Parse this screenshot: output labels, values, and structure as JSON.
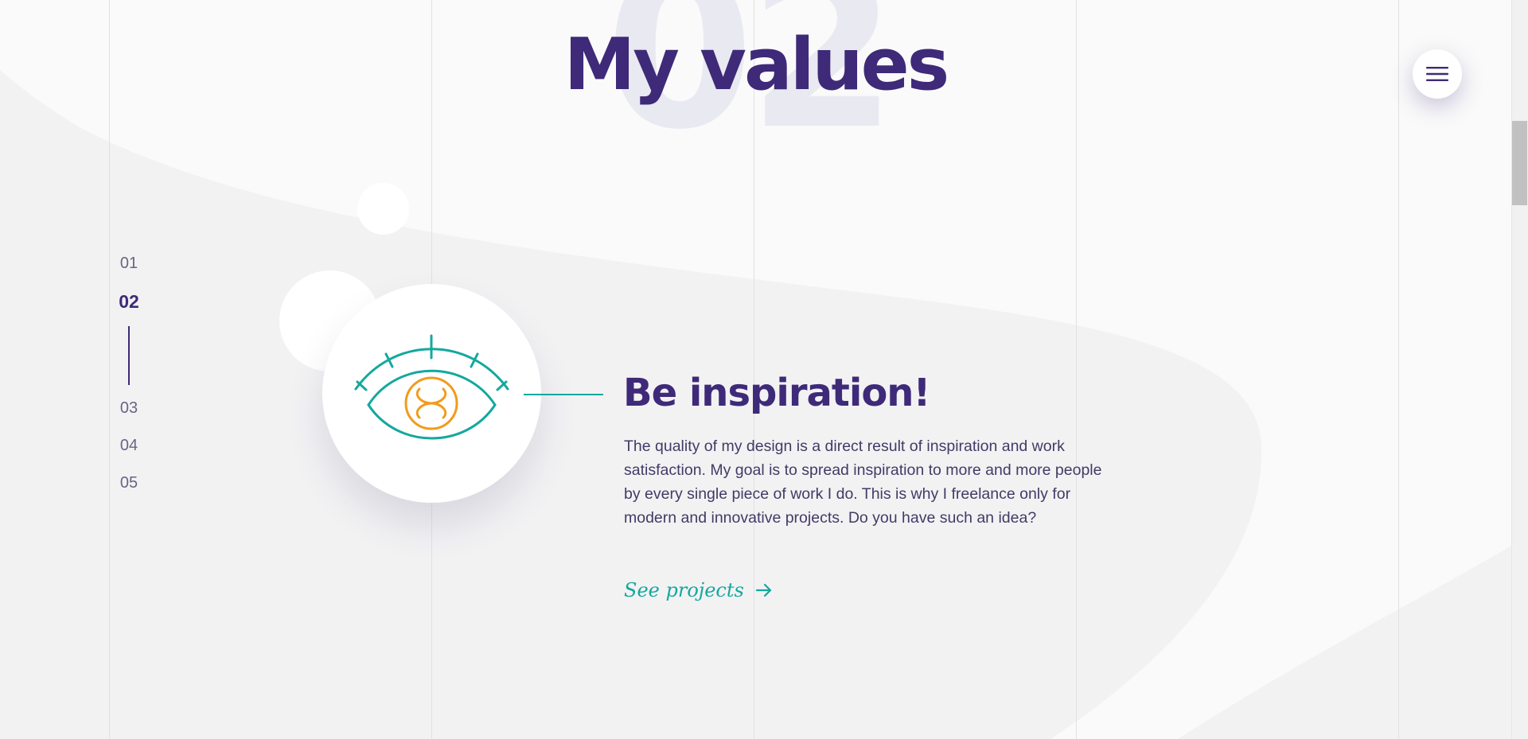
{
  "section": {
    "background_number": "02",
    "title": "My values"
  },
  "menu": {
    "icon": "hamburger-icon"
  },
  "side_nav": {
    "items": [
      {
        "label": "01",
        "active": false
      },
      {
        "label": "02",
        "active": true
      },
      {
        "label": "03",
        "active": false
      },
      {
        "label": "04",
        "active": false
      },
      {
        "label": "05",
        "active": false
      }
    ]
  },
  "value": {
    "icon": "eye-icon",
    "heading": "Be inspiration!",
    "text": "The quality of my design is a direct result of inspiration and work satisfaction. My goal is to spread inspiration to more and more people by every single piece of work I do. This is why I freelance only for modern and innovative projects. Do you have such an idea?",
    "link_label": "See projects",
    "link_icon": "arrow-right-icon"
  },
  "colors": {
    "primary": "#3e2a78",
    "accent": "#14a89e",
    "highlight": "#f29b1d",
    "background": "#f2f2f3"
  }
}
